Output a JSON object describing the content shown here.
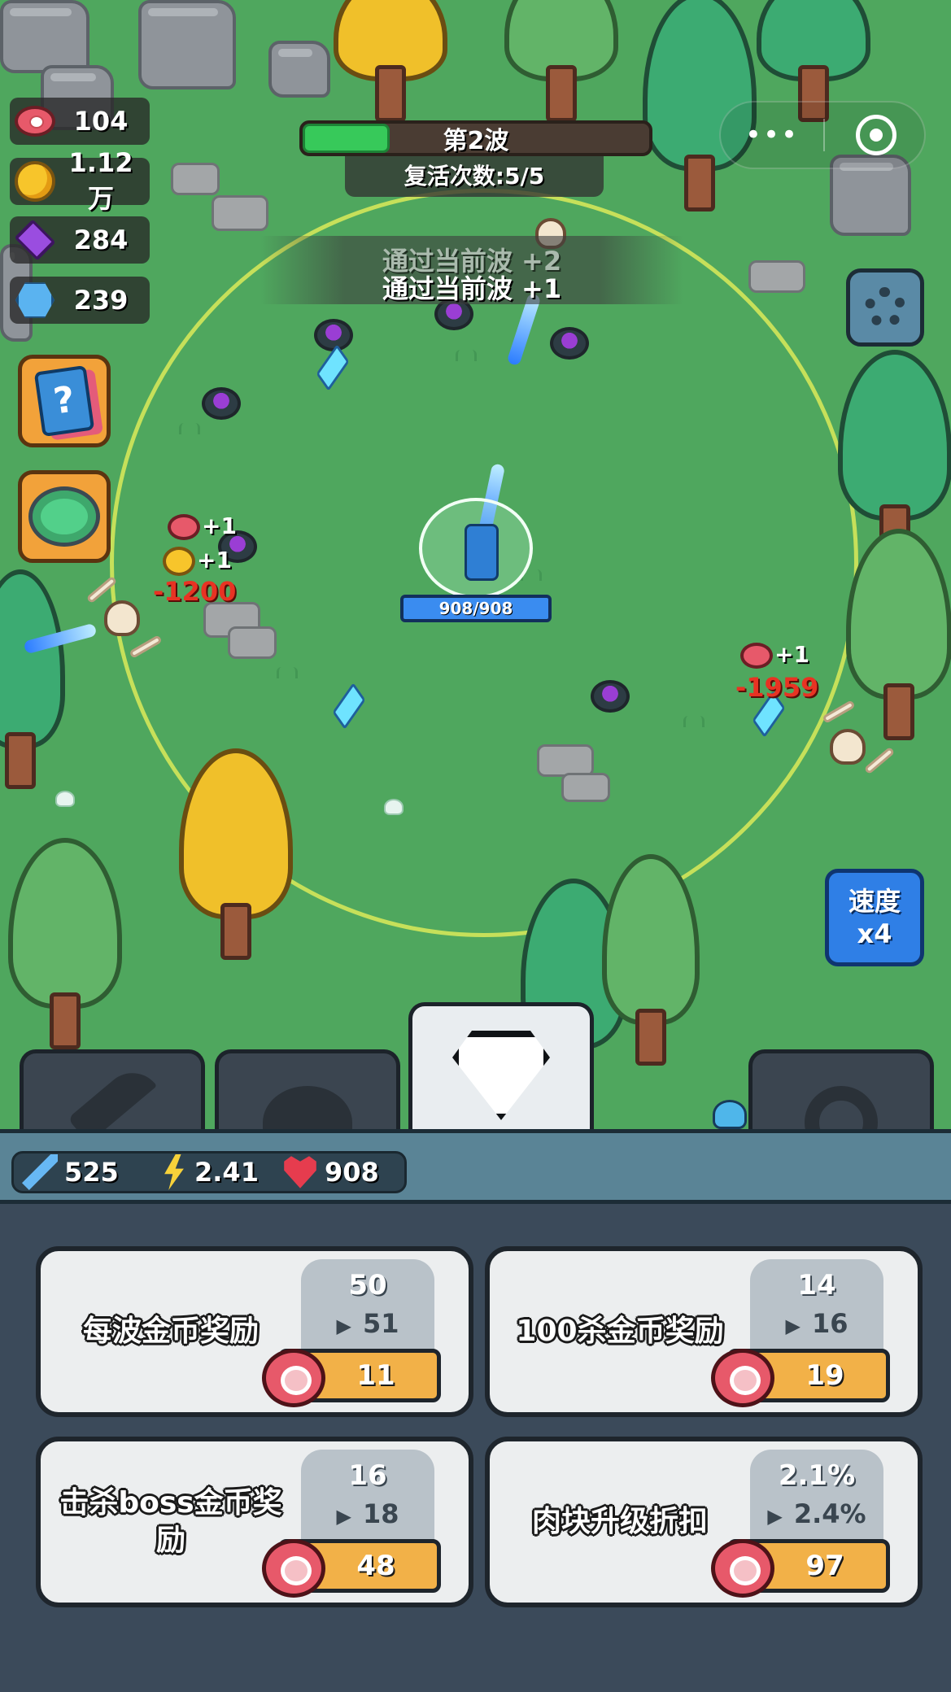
{
  "resources": {
    "meat": "104",
    "gold": "1.12万",
    "gems": "284",
    "crystals": "239"
  },
  "wave": {
    "label": "第2波",
    "progress": 0.25,
    "revive": "复活次数:5/5"
  },
  "toasts": {
    "faded": "通过当前波 +2",
    "main": "通过当前波 +1"
  },
  "capsule": {
    "dots": "•••"
  },
  "side_buttons": {
    "cards_glyph": "?"
  },
  "hero": {
    "hp": "908/908"
  },
  "floating": {
    "meat_plus": "+1",
    "gold_plus": "+1",
    "dmg_left": "-1200",
    "meat_plus_right": "+1",
    "dmg_right": "-1959"
  },
  "speed": {
    "line1": "速度",
    "line2": "x4"
  },
  "tabs": [
    {
      "icon": "sword-icon",
      "active": false
    },
    {
      "icon": "heart-icon",
      "active": false
    },
    {
      "icon": "diamond-icon",
      "active": true
    },
    {
      "icon": "gear-icon",
      "active": false
    }
  ],
  "stats": {
    "attack": "525",
    "speed": "2.41",
    "health": "908"
  },
  "upgrades": [
    {
      "title": "每波金币奖励",
      "current": "50",
      "next": "51",
      "cost": "11"
    },
    {
      "title": "100杀金币奖励",
      "current": "14",
      "next": "16",
      "cost": "19"
    },
    {
      "title": "击杀boss金币奖励",
      "current": "16",
      "next": "18",
      "cost": "48"
    },
    {
      "title": "肉块升级折扣",
      "current": "2.1%",
      "next": "2.4%",
      "cost": "97"
    }
  ],
  "arrow": "▶",
  "colors": {
    "grass": "#4fa75e",
    "panel": "#3b4a5a",
    "wave_fill": "#37c95a",
    "cost_button": "#f2b148",
    "speed_button": "#2f7fe6",
    "damage_text": "#e83323"
  }
}
